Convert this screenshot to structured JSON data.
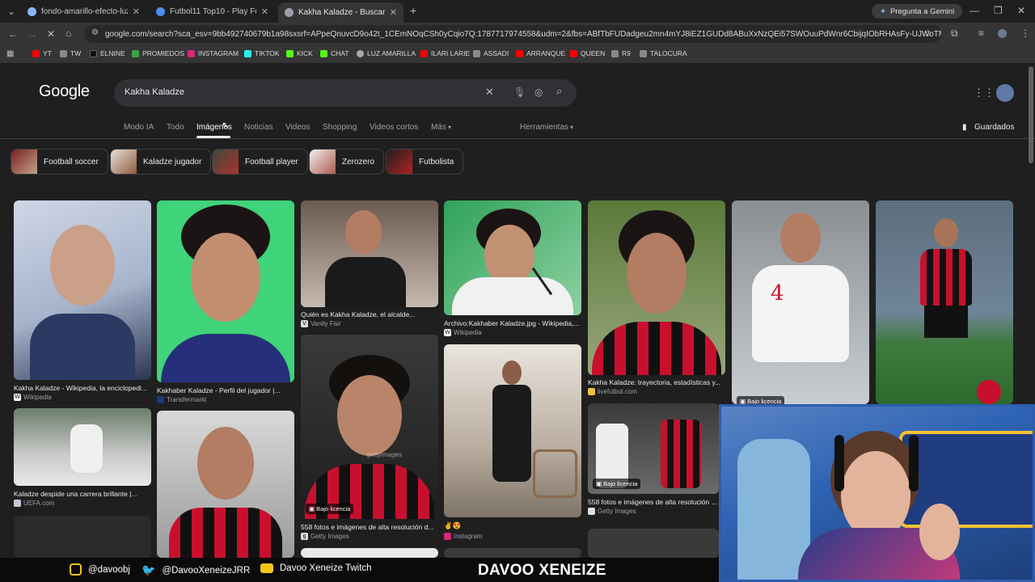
{
  "browser": {
    "tabs": [
      {
        "title": "fondo-amarillo-efecto-luz-brilla"
      },
      {
        "title": "Futbol11 Top10 - Play Football"
      },
      {
        "title": "Kakha Kaladze - Buscar con Google"
      }
    ],
    "gemini_button": "Pregunta a Gemini",
    "url": "google.com/search?sca_esv=9bb492740679b1a98sxsrf=APpeQnuvcD9o42t_1CEmNOqCSh0yCqio7Q:1787717974558&udm=2&fbs=ABfTbFUDadgeu2mn4mYJ8iEZ1GUDd8ABuXxNzQEi57SWOuuPdWnr6CbijqIObRHAsFy-UJWoTM8aZiBG_34l3e...",
    "bookmarks": [
      "YT",
      "TW",
      "ELNINE",
      "PROMIEDOS",
      "INSTAGRAM",
      "TIKTOK",
      "KICK",
      "CHAT",
      "LUZ AMARILLA",
      "ILARI LARIE",
      "ASSADI",
      "ARRANQUE",
      "QUEEN",
      "R9",
      "TALOCURA"
    ]
  },
  "google": {
    "logo": "Google",
    "query": "Kakha Kaladze",
    "tabs": [
      "Modo IA",
      "Todo",
      "Imágenes",
      "Noticias",
      "Videos",
      "Shopping",
      "Videos cortos",
      "Más"
    ],
    "tools": "Herramientas",
    "saved": "Guardados",
    "chips": [
      "Football soccer",
      "Kaladze jugador",
      "Football player",
      "Zerozero",
      "Futbolista"
    ],
    "results": [
      {
        "caption": "Kakha Kaladze - Wikipedia, la enciclopedi...",
        "source": "Wikipedia"
      },
      {
        "caption": "Kakhaber Kaladze - Perfil del jugador |...",
        "source": "Transfermarkt"
      },
      {
        "caption": "Quién es Kakha Kaladze, el alcalde...",
        "source": "Vanity Fair"
      },
      {
        "caption": "Archivo:Kakhaber Kaladze.jpg - Wikipedia,...",
        "source": "Wikipedia"
      },
      {
        "caption": "Kakha Kaladze: trayectoria, estadísticas y...",
        "source": "livefutbol.com"
      },
      {
        "caption": "Kaladze despide una carrera brillante |...",
        "source": "UEFA.com"
      },
      {
        "caption": "558 fotos e imágenes de alta resolución d...",
        "source": "Getty Images"
      },
      {
        "caption": "",
        "source": "Instagram",
        "emoji": "✌️😍"
      },
      {
        "caption": "558 fotos e imágenes de alta resolución d...",
        "source": "Getty Images"
      }
    ],
    "badge_license": "Bajo licencia",
    "watermark": "gettyimages"
  },
  "overlay": {
    "instagram": "@davoobj",
    "twitter": "@DavooXeneizeJRR",
    "youtube": "Davoo Xeneize Twitch",
    "brand": "DAVOO XENEIZE"
  },
  "colors": {
    "accent": "#8ab4f8",
    "milan_red": "#c8102e"
  }
}
